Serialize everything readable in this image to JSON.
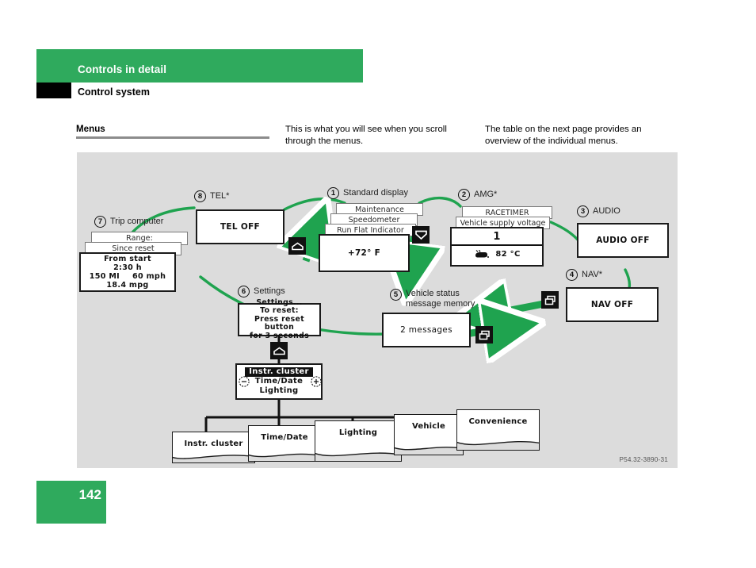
{
  "header": {
    "chapter": "Controls in detail",
    "section": "Control system"
  },
  "intro": {
    "menus_label": "Menus",
    "column2": "This is what you will see when you scroll through the menus.",
    "column3": "The table on the next page provides an overview of the individual menus."
  },
  "figure": {
    "caption": "P54.32-3890-31",
    "colors": {
      "brand_green": "#2faa5d",
      "flow_green": "#1fa34f",
      "panel_gray": "#dcdcdc"
    },
    "callouts": [
      {
        "num": "1",
        "label": "Standard display"
      },
      {
        "num": "2",
        "label": "AMG*"
      },
      {
        "num": "3",
        "label": "AUDIO"
      },
      {
        "num": "4",
        "label": "NAV*"
      },
      {
        "num": "5",
        "label": "Vehicle status\nmessage memory"
      },
      {
        "num": "6",
        "label": "Settings"
      },
      {
        "num": "7",
        "label": "Trip computer"
      },
      {
        "num": "8",
        "label": "TEL*"
      }
    ],
    "trip_computer": {
      "back2": "Range:",
      "back1": "Since reset",
      "front_title": "From start",
      "front_time": "2:30 h",
      "front_distance": "150 MI",
      "front_speed": "60 mph",
      "front_economy": "18.4 mpg"
    },
    "tel": {
      "text": "TEL OFF"
    },
    "standard_display": {
      "back3": "Maintenance",
      "back2": "Speedometer",
      "back1": "Run Flat Indicator",
      "front": "+72° F"
    },
    "amg": {
      "back2": "RACETIMER",
      "back1": "Vehicle supply voltage",
      "front_value": "1",
      "front_oil_temp": "82 °C"
    },
    "audio": {
      "text": "AUDIO OFF"
    },
    "nav": {
      "text": "NAV OFF"
    },
    "vehicle_status": {
      "text": "2 messages"
    },
    "settings": {
      "line1": "Settings...",
      "line2": "To reset:",
      "line3": "Press reset button",
      "line4": "for 3 seconds"
    },
    "submenu": {
      "selected": "Instr. cluster",
      "line2": "Time/Date",
      "line3": "Lighting",
      "minus": "−",
      "plus": "+"
    },
    "bottom_tabs": [
      {
        "label": "Instr. cluster"
      },
      {
        "label": "Time/Date"
      },
      {
        "label": "Lighting"
      },
      {
        "label": "Vehicle"
      },
      {
        "label": "Convenience"
      }
    ],
    "icon_keys": [
      {
        "name": "home-icon"
      },
      {
        "name": "down-arrow-icon"
      },
      {
        "name": "back-icon"
      },
      {
        "name": "back-icon"
      },
      {
        "name": "home-icon"
      }
    ]
  },
  "footer": {
    "page_number": "142"
  }
}
